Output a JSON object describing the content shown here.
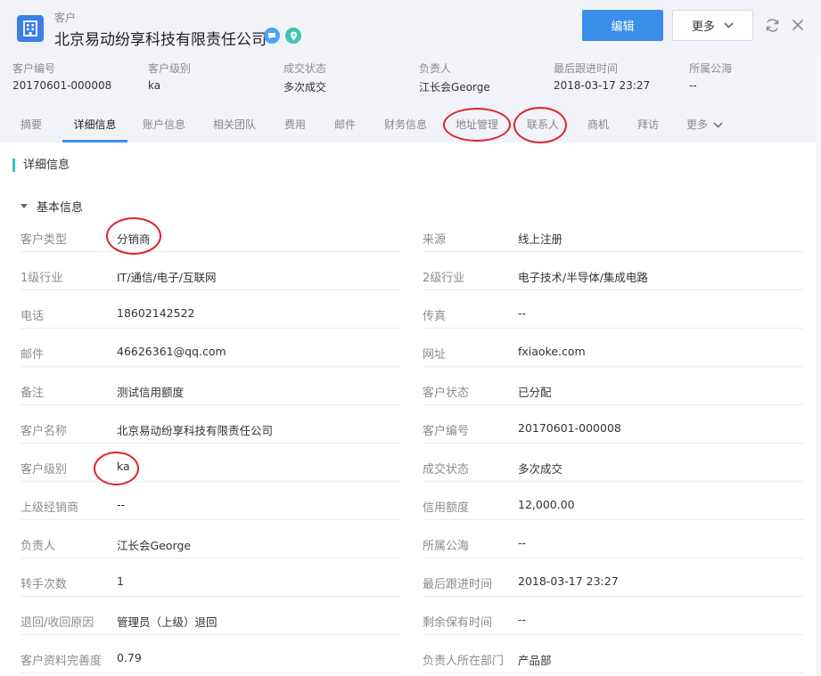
{
  "header": {
    "object_type": "客户",
    "title": "北京易动纷享科技有限责任公司",
    "edit_label": "编辑",
    "more_label": "更多"
  },
  "summary": [
    {
      "label": "客户编号",
      "value": "20170601-000008"
    },
    {
      "label": "客户级别",
      "value": "ka"
    },
    {
      "label": "成交状态",
      "value": "多次成交"
    },
    {
      "label": "负责人",
      "value": "江长会George"
    },
    {
      "label": "最后跟进时间",
      "value": "2018-03-17 23:27"
    },
    {
      "label": "所属公海",
      "value": "--"
    }
  ],
  "tabs": [
    {
      "label": "摘要"
    },
    {
      "label": "详细信息"
    },
    {
      "label": "账户信息"
    },
    {
      "label": "相关团队"
    },
    {
      "label": "费用"
    },
    {
      "label": "邮件"
    },
    {
      "label": "财务信息"
    },
    {
      "label": "地址管理"
    },
    {
      "label": "联系人"
    },
    {
      "label": "商机"
    },
    {
      "label": "拜访"
    },
    {
      "label": "更多"
    }
  ],
  "active_tab": "详细信息",
  "section_title": "详细信息",
  "group_title": "基本信息",
  "fields": [
    {
      "left": {
        "label": "客户类型",
        "value": "分销商"
      },
      "right": {
        "label": "来源",
        "value": "线上注册"
      }
    },
    {
      "left": {
        "label": "1级行业",
        "value": "IT/通信/电子/互联网"
      },
      "right": {
        "label": "2级行业",
        "value": "电子技术/半导体/集成电路"
      }
    },
    {
      "left": {
        "label": "电话",
        "value": "18602142522"
      },
      "right": {
        "label": "传真",
        "value": "--"
      }
    },
    {
      "left": {
        "label": "邮件",
        "value": "46626361@qq.com"
      },
      "right": {
        "label": "网址",
        "value": "fxiaoke.com"
      }
    },
    {
      "left": {
        "label": "备注",
        "value": "测试信用额度"
      },
      "right": {
        "label": "客户状态",
        "value": "已分配"
      }
    },
    {
      "left": {
        "label": "客户名称",
        "value": "北京易动纷享科技有限责任公司"
      },
      "right": {
        "label": "客户编号",
        "value": "20170601-000008"
      }
    },
    {
      "left": {
        "label": "客户级别",
        "value": "ka"
      },
      "right": {
        "label": "成交状态",
        "value": "多次成交"
      }
    },
    {
      "left": {
        "label": "上级经销商",
        "value": "--"
      },
      "right": {
        "label": "信用额度",
        "value": "12,000.00"
      }
    },
    {
      "left": {
        "label": "负责人",
        "value": "江长会George"
      },
      "right": {
        "label": "所属公海",
        "value": "--"
      }
    },
    {
      "left": {
        "label": "转手次数",
        "value": "1"
      },
      "right": {
        "label": "最后跟进时间",
        "value": "2018-03-17 23:27"
      }
    },
    {
      "left": {
        "label": "退回/收回原因",
        "value": "管理员（上级）退回"
      },
      "right": {
        "label": "剩余保有时间",
        "value": "--"
      }
    },
    {
      "left": {
        "label": "客户资料完善度",
        "value": "0.79"
      },
      "right": {
        "label": "负责人所在部门",
        "value": "产品部"
      }
    }
  ],
  "icons": {
    "app": "building-icon",
    "message": "chat-bubble-icon",
    "location": "location-pin-icon",
    "refresh": "refresh-icon",
    "close": "close-icon",
    "chevron": "chevron-down-icon"
  },
  "colors": {
    "accent": "#3b8ee8",
    "header_bg": "#f1f3f8",
    "annotation": "#e0202a",
    "section_marker": "#2ec5c5"
  }
}
